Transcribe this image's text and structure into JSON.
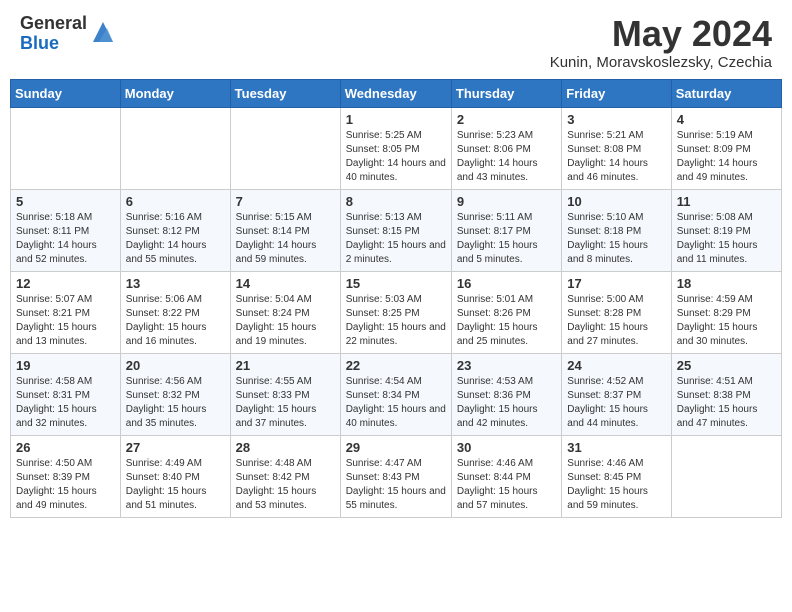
{
  "header": {
    "logo_general": "General",
    "logo_blue": "Blue",
    "month_title": "May 2024",
    "location": "Kunin, Moravskoslezsky, Czechia"
  },
  "weekdays": [
    "Sunday",
    "Monday",
    "Tuesday",
    "Wednesday",
    "Thursday",
    "Friday",
    "Saturday"
  ],
  "weeks": [
    [
      {
        "day": "",
        "sunrise": "",
        "sunset": "",
        "daylight": ""
      },
      {
        "day": "",
        "sunrise": "",
        "sunset": "",
        "daylight": ""
      },
      {
        "day": "",
        "sunrise": "",
        "sunset": "",
        "daylight": ""
      },
      {
        "day": "1",
        "sunrise": "Sunrise: 5:25 AM",
        "sunset": "Sunset: 8:05 PM",
        "daylight": "Daylight: 14 hours and 40 minutes."
      },
      {
        "day": "2",
        "sunrise": "Sunrise: 5:23 AM",
        "sunset": "Sunset: 8:06 PM",
        "daylight": "Daylight: 14 hours and 43 minutes."
      },
      {
        "day": "3",
        "sunrise": "Sunrise: 5:21 AM",
        "sunset": "Sunset: 8:08 PM",
        "daylight": "Daylight: 14 hours and 46 minutes."
      },
      {
        "day": "4",
        "sunrise": "Sunrise: 5:19 AM",
        "sunset": "Sunset: 8:09 PM",
        "daylight": "Daylight: 14 hours and 49 minutes."
      }
    ],
    [
      {
        "day": "5",
        "sunrise": "Sunrise: 5:18 AM",
        "sunset": "Sunset: 8:11 PM",
        "daylight": "Daylight: 14 hours and 52 minutes."
      },
      {
        "day": "6",
        "sunrise": "Sunrise: 5:16 AM",
        "sunset": "Sunset: 8:12 PM",
        "daylight": "Daylight: 14 hours and 55 minutes."
      },
      {
        "day": "7",
        "sunrise": "Sunrise: 5:15 AM",
        "sunset": "Sunset: 8:14 PM",
        "daylight": "Daylight: 14 hours and 59 minutes."
      },
      {
        "day": "8",
        "sunrise": "Sunrise: 5:13 AM",
        "sunset": "Sunset: 8:15 PM",
        "daylight": "Daylight: 15 hours and 2 minutes."
      },
      {
        "day": "9",
        "sunrise": "Sunrise: 5:11 AM",
        "sunset": "Sunset: 8:17 PM",
        "daylight": "Daylight: 15 hours and 5 minutes."
      },
      {
        "day": "10",
        "sunrise": "Sunrise: 5:10 AM",
        "sunset": "Sunset: 8:18 PM",
        "daylight": "Daylight: 15 hours and 8 minutes."
      },
      {
        "day": "11",
        "sunrise": "Sunrise: 5:08 AM",
        "sunset": "Sunset: 8:19 PM",
        "daylight": "Daylight: 15 hours and 11 minutes."
      }
    ],
    [
      {
        "day": "12",
        "sunrise": "Sunrise: 5:07 AM",
        "sunset": "Sunset: 8:21 PM",
        "daylight": "Daylight: 15 hours and 13 minutes."
      },
      {
        "day": "13",
        "sunrise": "Sunrise: 5:06 AM",
        "sunset": "Sunset: 8:22 PM",
        "daylight": "Daylight: 15 hours and 16 minutes."
      },
      {
        "day": "14",
        "sunrise": "Sunrise: 5:04 AM",
        "sunset": "Sunset: 8:24 PM",
        "daylight": "Daylight: 15 hours and 19 minutes."
      },
      {
        "day": "15",
        "sunrise": "Sunrise: 5:03 AM",
        "sunset": "Sunset: 8:25 PM",
        "daylight": "Daylight: 15 hours and 22 minutes."
      },
      {
        "day": "16",
        "sunrise": "Sunrise: 5:01 AM",
        "sunset": "Sunset: 8:26 PM",
        "daylight": "Daylight: 15 hours and 25 minutes."
      },
      {
        "day": "17",
        "sunrise": "Sunrise: 5:00 AM",
        "sunset": "Sunset: 8:28 PM",
        "daylight": "Daylight: 15 hours and 27 minutes."
      },
      {
        "day": "18",
        "sunrise": "Sunrise: 4:59 AM",
        "sunset": "Sunset: 8:29 PM",
        "daylight": "Daylight: 15 hours and 30 minutes."
      }
    ],
    [
      {
        "day": "19",
        "sunrise": "Sunrise: 4:58 AM",
        "sunset": "Sunset: 8:31 PM",
        "daylight": "Daylight: 15 hours and 32 minutes."
      },
      {
        "day": "20",
        "sunrise": "Sunrise: 4:56 AM",
        "sunset": "Sunset: 8:32 PM",
        "daylight": "Daylight: 15 hours and 35 minutes."
      },
      {
        "day": "21",
        "sunrise": "Sunrise: 4:55 AM",
        "sunset": "Sunset: 8:33 PM",
        "daylight": "Daylight: 15 hours and 37 minutes."
      },
      {
        "day": "22",
        "sunrise": "Sunrise: 4:54 AM",
        "sunset": "Sunset: 8:34 PM",
        "daylight": "Daylight: 15 hours and 40 minutes."
      },
      {
        "day": "23",
        "sunrise": "Sunrise: 4:53 AM",
        "sunset": "Sunset: 8:36 PM",
        "daylight": "Daylight: 15 hours and 42 minutes."
      },
      {
        "day": "24",
        "sunrise": "Sunrise: 4:52 AM",
        "sunset": "Sunset: 8:37 PM",
        "daylight": "Daylight: 15 hours and 44 minutes."
      },
      {
        "day": "25",
        "sunrise": "Sunrise: 4:51 AM",
        "sunset": "Sunset: 8:38 PM",
        "daylight": "Daylight: 15 hours and 47 minutes."
      }
    ],
    [
      {
        "day": "26",
        "sunrise": "Sunrise: 4:50 AM",
        "sunset": "Sunset: 8:39 PM",
        "daylight": "Daylight: 15 hours and 49 minutes."
      },
      {
        "day": "27",
        "sunrise": "Sunrise: 4:49 AM",
        "sunset": "Sunset: 8:40 PM",
        "daylight": "Daylight: 15 hours and 51 minutes."
      },
      {
        "day": "28",
        "sunrise": "Sunrise: 4:48 AM",
        "sunset": "Sunset: 8:42 PM",
        "daylight": "Daylight: 15 hours and 53 minutes."
      },
      {
        "day": "29",
        "sunrise": "Sunrise: 4:47 AM",
        "sunset": "Sunset: 8:43 PM",
        "daylight": "Daylight: 15 hours and 55 minutes."
      },
      {
        "day": "30",
        "sunrise": "Sunrise: 4:46 AM",
        "sunset": "Sunset: 8:44 PM",
        "daylight": "Daylight: 15 hours and 57 minutes."
      },
      {
        "day": "31",
        "sunrise": "Sunrise: 4:46 AM",
        "sunset": "Sunset: 8:45 PM",
        "daylight": "Daylight: 15 hours and 59 minutes."
      },
      {
        "day": "",
        "sunrise": "",
        "sunset": "",
        "daylight": ""
      }
    ]
  ]
}
